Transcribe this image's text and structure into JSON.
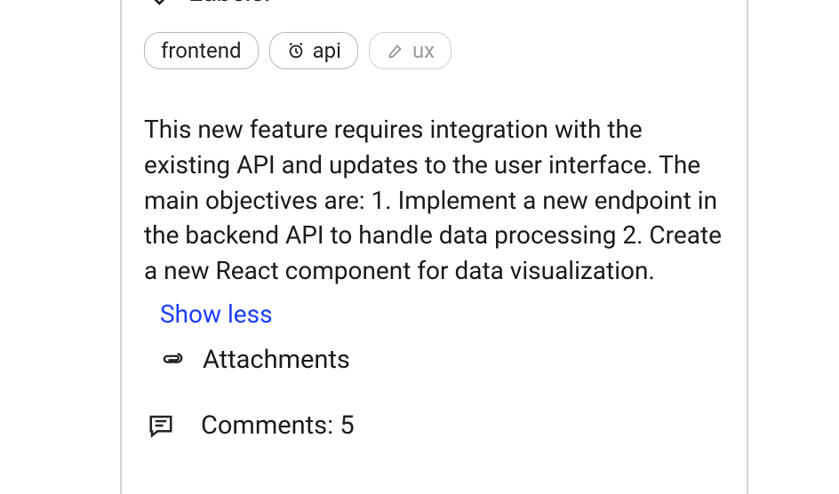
{
  "labels": {
    "heading": "Labels:",
    "chips": [
      {
        "text": "frontend",
        "icon": null,
        "disabled": false
      },
      {
        "text": "api",
        "icon": "alarm",
        "disabled": false
      },
      {
        "text": "ux",
        "icon": "brush",
        "disabled": true
      }
    ]
  },
  "description": "This new feature requires integration with the existing API and updates to the user interface. The main objectives are: 1. Implement a new endpoint in the backend API to handle data processing 2. Create a new React component for data visualization.",
  "show_less": "Show less",
  "attachments": "Attachments",
  "comments": {
    "label_prefix": "Comments: ",
    "count": 5
  }
}
